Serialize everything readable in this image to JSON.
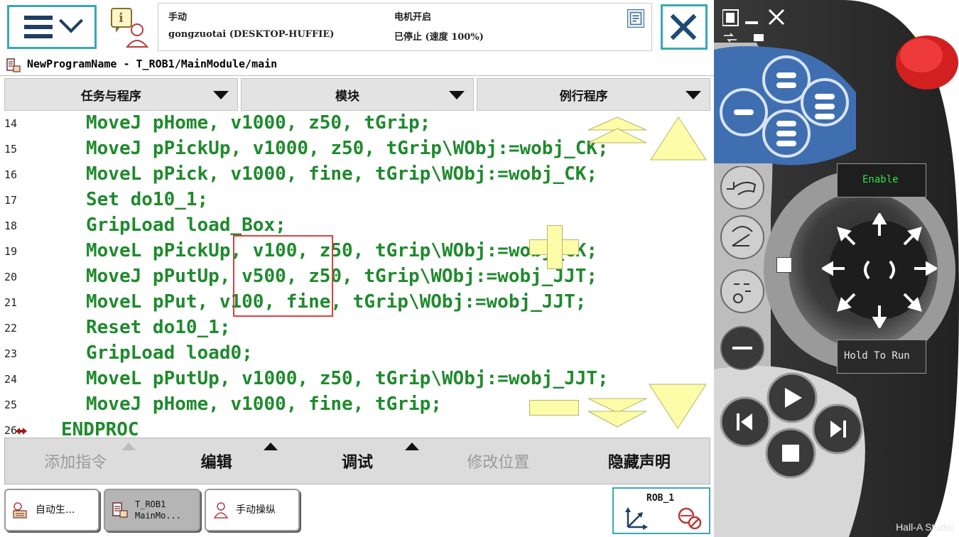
{
  "status": {
    "mode": "手动",
    "controller": "gongzuotai (DESKTOP-HUFFIE)",
    "motor": "电机开启",
    "state": "已停止 (速度 100%)"
  },
  "path": "NewProgramName - T_ROB1/MainModule/main",
  "tabs": [
    "任务与程序",
    "模块",
    "例行程序"
  ],
  "code_lines": [
    {
      "num": "14",
      "text": "MoveJ pHome, v1000, z50, tGrip;"
    },
    {
      "num": "15",
      "text": "MoveJ pPickUp, v1000, z50, tGrip\\WObj:=wobj_CK;"
    },
    {
      "num": "16",
      "text": "MoveL pPick, v1000, fine, tGrip\\WObj:=wobj_CK;"
    },
    {
      "num": "17",
      "text": "Set do10_1;"
    },
    {
      "num": "18",
      "text": "GripLoad load_Box;"
    },
    {
      "num": "19",
      "text": "MoveL pPickUp, v100, z50, tGrip\\WObj:=wobj_CK;"
    },
    {
      "num": "20",
      "text": "MoveJ pPutUp, v500, z50, tGrip\\WObj:=wobj_JJT;"
    },
    {
      "num": "21",
      "text": "MoveL pPut, v100, fine, tGrip\\WObj:=wobj_JJT;"
    },
    {
      "num": "22",
      "text": "Reset do10_1;"
    },
    {
      "num": "23",
      "text": "GripLoad load0;"
    },
    {
      "num": "24",
      "text": "MoveL pPutUp, v1000, z50, tGrip\\WObj:=wobj_JJT;"
    },
    {
      "num": "25",
      "text": "MoveJ pHome, v1000, fine, tGrip;"
    },
    {
      "num": "26",
      "text": "ENDPROC"
    }
  ],
  "commands": [
    {
      "label": "添加指令",
      "enabled": false
    },
    {
      "label": "编辑",
      "enabled": true
    },
    {
      "label": "调试",
      "enabled": true
    },
    {
      "label": "修改位置",
      "enabled": false
    },
    {
      "label": "隐藏声明",
      "enabled": true
    }
  ],
  "taskbar": {
    "task1": "自动生...",
    "task2_line1": "T_ROB1",
    "task2_line2": "MainMo...",
    "task3": "手动操纵",
    "rob": "ROB_1"
  },
  "device": {
    "enable_label": "Enable",
    "hold_label": "Hold To Run",
    "watermark": "Hall-A Studio"
  },
  "colors": {
    "accent": "#39a8b4",
    "code_green": "#1f8a2d",
    "highlight_red": "#e04040",
    "overlay_yellow": "#fdfca8",
    "device_blue": "#3f6fb0"
  }
}
